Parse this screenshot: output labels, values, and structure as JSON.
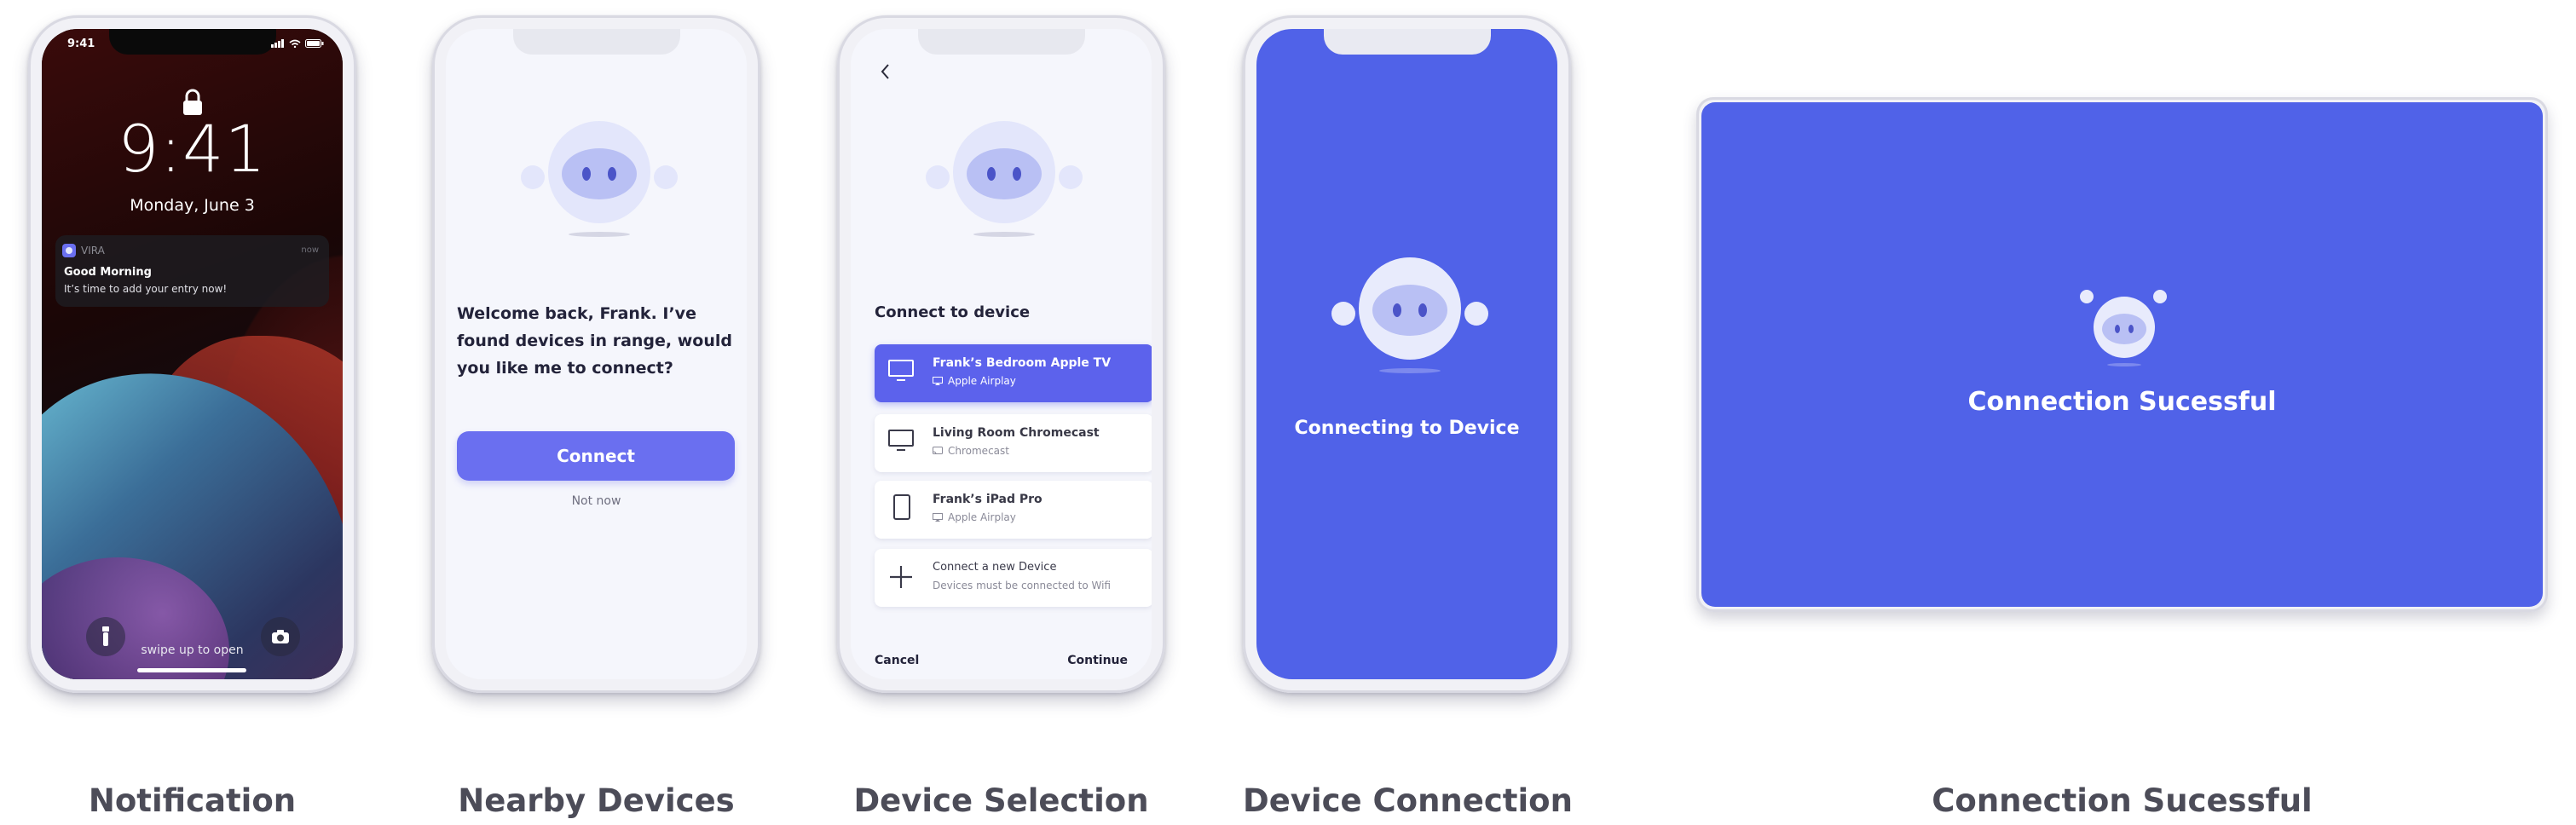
{
  "labels": {
    "notification": "Notification",
    "nearby": "Nearby Devices",
    "selection": "Device Selection",
    "connection": "Device Connection",
    "success": "Connection Sucessful"
  },
  "lock": {
    "status_time": "9:41",
    "time": "9:41",
    "date": "Monday, June 3",
    "notif_app": "VIRA",
    "notif_time": "now",
    "notif_title": "Good Morning",
    "notif_body": "It’s time to add your entry now!",
    "swipe_hint": "swipe up to open"
  },
  "nearby": {
    "message": "Welcome back, Frank. I’ve found devices in range, would you like me to connect?",
    "connect_label": "Connect",
    "not_now_label": "Not now"
  },
  "selection": {
    "heading": "Connect to device",
    "devices": [
      {
        "title": "Frank’s Bedroom Apple TV",
        "sub": "Apple Airplay",
        "icon": "monitor-icon",
        "selected": true
      },
      {
        "title": "Living Room Chromecast",
        "sub": "Chromecast",
        "icon": "monitor-icon",
        "selected": false
      },
      {
        "title": "Frank’s iPad Pro",
        "sub": "Apple Airplay",
        "icon": "tablet-icon",
        "selected": false
      }
    ],
    "add_title": "Connect a new Device",
    "add_sub": "Devices must be connected to Wifi",
    "cancel_label": "Cancel",
    "continue_label": "Continue"
  },
  "connecting": {
    "text": "Connecting to Device"
  },
  "success": {
    "text": "Connection Sucessful"
  },
  "colors": {
    "brand": "#5062e8",
    "button": "#6a6ff0",
    "robot_light": "#e3e6fb",
    "robot_mid": "#b9c0f4",
    "robot_dark": "#4b54c8"
  }
}
